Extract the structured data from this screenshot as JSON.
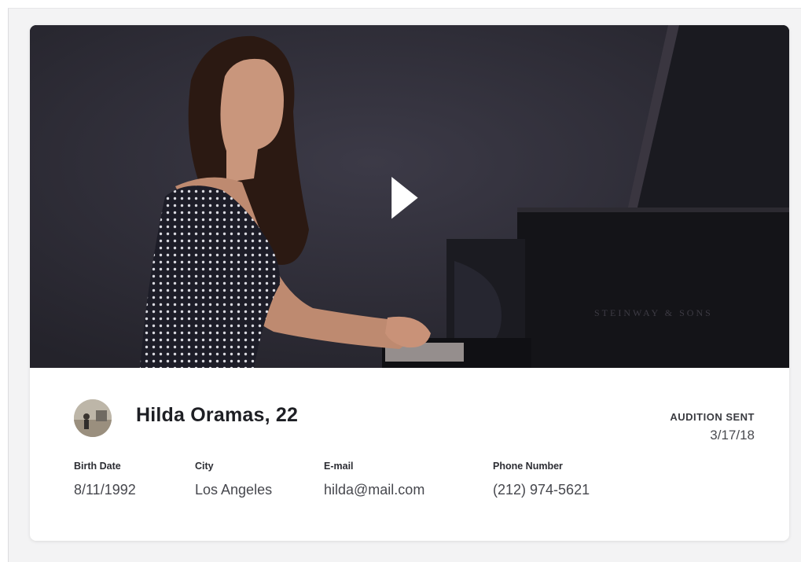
{
  "candidate": {
    "name_age": "Hilda Oramas, 22",
    "status_label": "AUDITION SENT",
    "status_date": "3/17/18"
  },
  "details": [
    {
      "label": "Birth Date",
      "value": "8/11/1992"
    },
    {
      "label": "City",
      "value": "Los Angeles"
    },
    {
      "label": "E-mail",
      "value": "hilda@mail.com"
    },
    {
      "label": "Phone Number",
      "value": "(212) 974-5621"
    }
  ],
  "video": {
    "play_icon": "play-icon",
    "piano_brand": "STEINWAY & SONS"
  },
  "colors": {
    "video_background": "#2b2b33",
    "name_text": "#1e1f24",
    "card_background": "#ffffff",
    "page_background": "#f3f3f4"
  }
}
